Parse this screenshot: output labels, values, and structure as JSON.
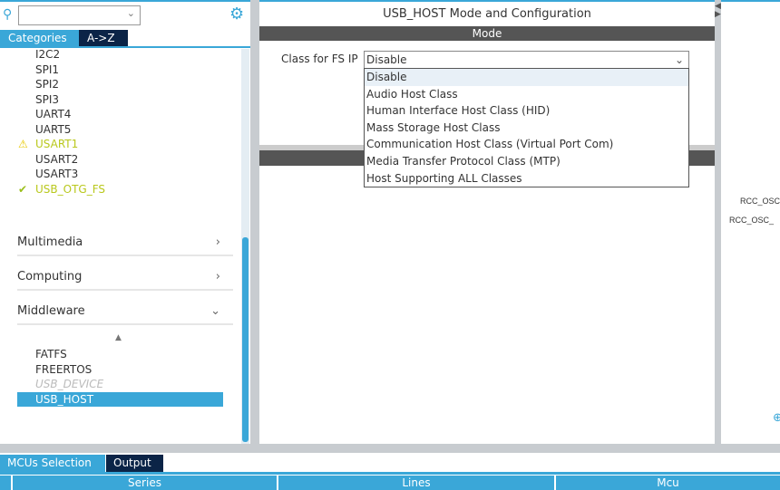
{
  "left": {
    "search": {
      "value": ""
    },
    "tabs": [
      "Categories",
      "A->Z"
    ],
    "peripherals": [
      {
        "label": "I2C2",
        "status": ""
      },
      {
        "label": "SPI1",
        "status": ""
      },
      {
        "label": "SPI2",
        "status": ""
      },
      {
        "label": "SPI3",
        "status": ""
      },
      {
        "label": "UART4",
        "status": ""
      },
      {
        "label": "UART5",
        "status": ""
      },
      {
        "label": "USART1",
        "status": "warning"
      },
      {
        "label": "USART2",
        "status": ""
      },
      {
        "label": "USART3",
        "status": ""
      },
      {
        "label": "USB_OTG_FS",
        "status": "ok"
      }
    ],
    "categories": [
      {
        "label": "Multimedia",
        "expanded": false
      },
      {
        "label": "Computing",
        "expanded": false
      },
      {
        "label": "Middleware",
        "expanded": true
      }
    ],
    "middleware": [
      {
        "label": "FATFS",
        "state": "normal"
      },
      {
        "label": "FREERTOS",
        "state": "normal"
      },
      {
        "label": "USB_DEVICE",
        "state": "disabled"
      },
      {
        "label": "USB_HOST",
        "state": "selected"
      }
    ]
  },
  "main": {
    "title": "USB_HOST Mode and Configuration",
    "mode_header": "Mode",
    "class_label": "Class for FS IP",
    "class_value": "Disable",
    "options": [
      "Disable",
      "Audio Host Class",
      "Human Interface Host Class (HID)",
      "Mass Storage Host Class",
      "Communication Host Class (Virtual Port Com)",
      "Media Transfer Protocol Class (MTP)",
      "Host Supporting ALL Classes"
    ]
  },
  "right": {
    "pins": [
      "RCC_OSC",
      "RCC_OSC_"
    ]
  },
  "bottom": {
    "tabs": [
      "MCUs Selection",
      "Output"
    ],
    "columns": [
      "Series",
      "Lines",
      "Mcu"
    ]
  },
  "colors": {
    "accent": "#3aa7d8",
    "dark_tab": "#0b2447",
    "warning": "#b9c81c"
  }
}
